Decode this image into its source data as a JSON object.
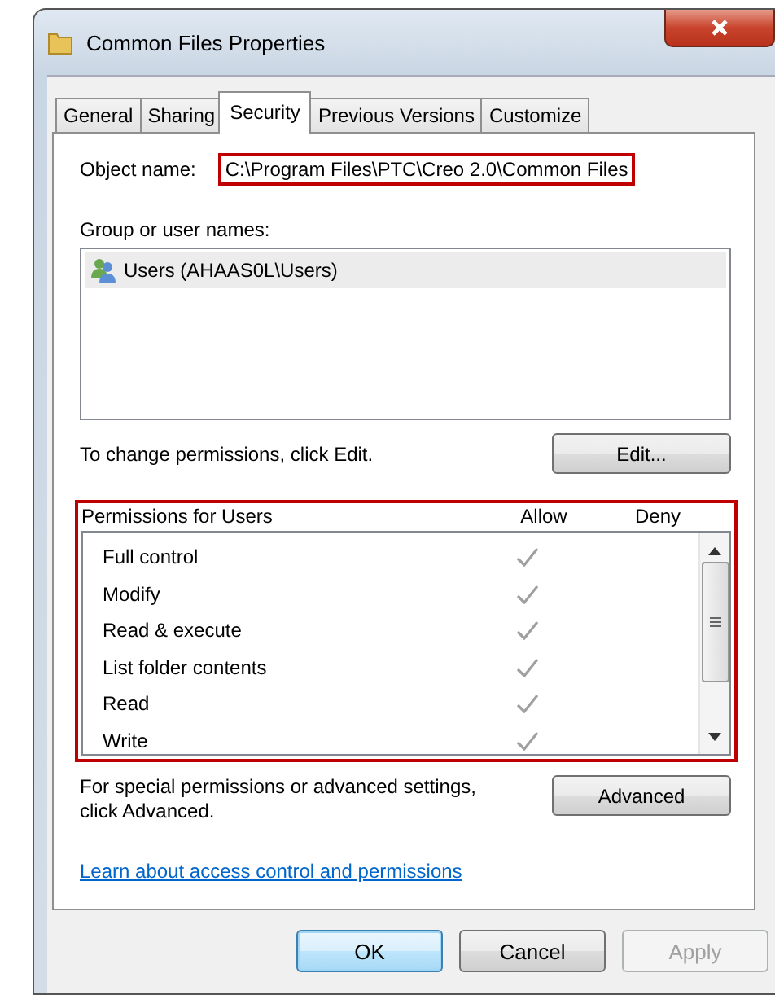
{
  "window": {
    "title": "Common Files Properties"
  },
  "tabs": [
    {
      "label": "General",
      "selected": false
    },
    {
      "label": "Sharing",
      "selected": false
    },
    {
      "label": "Security",
      "selected": true
    },
    {
      "label": "Previous Versions",
      "selected": false
    },
    {
      "label": "Customize",
      "selected": false
    }
  ],
  "object_name": {
    "label": "Object name:",
    "value": "C:\\Program Files\\PTC\\Creo 2.0\\Common Files",
    "highlighted": true
  },
  "group_list": {
    "label": "Group or user names:",
    "items": [
      {
        "name": "Users (AHAAS0L\\Users)",
        "selected": true
      }
    ]
  },
  "edit_hint": "To change permissions, click Edit.",
  "edit_button": "Edit...",
  "permissions": {
    "title": "Permissions for Users",
    "allow_header": "Allow",
    "deny_header": "Deny",
    "highlighted": true,
    "rows": [
      {
        "name": "Full control",
        "allow": true,
        "deny": false
      },
      {
        "name": "Modify",
        "allow": true,
        "deny": false
      },
      {
        "name": "Read & execute",
        "allow": true,
        "deny": false
      },
      {
        "name": "List folder contents",
        "allow": true,
        "deny": false
      },
      {
        "name": "Read",
        "allow": true,
        "deny": false
      },
      {
        "name": "Write",
        "allow": true,
        "deny": false
      }
    ]
  },
  "advanced_hint": "For special permissions or advanced settings, click Advanced.",
  "advanced_button": "Advanced",
  "link": "Learn about access control and permissions",
  "buttons": [
    {
      "label": "OK",
      "kind": "default",
      "disabled": false
    },
    {
      "label": "Cancel",
      "kind": "normal",
      "disabled": false
    },
    {
      "label": "Apply",
      "kind": "normal",
      "disabled": true
    }
  ]
}
